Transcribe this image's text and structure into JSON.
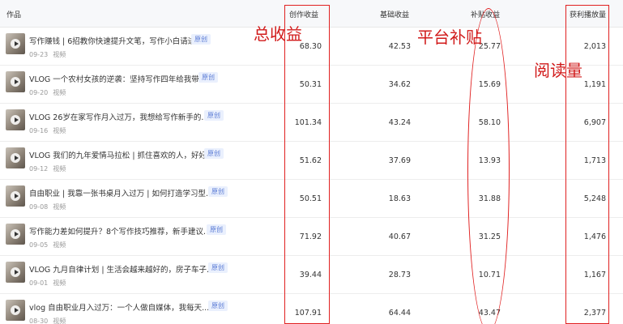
{
  "header": {
    "work": "作品",
    "total_income": "创作收益",
    "base_income": "基础收益",
    "subsidy_income": "补贴收益",
    "plays": "获利播放量"
  },
  "annotations": {
    "total": "总收益",
    "platform_subsidy": "平台补贴",
    "reads": "阅读量",
    "color": "#e02020"
  },
  "rows": [
    {
      "title": "写作赚钱 | 6招教你快速提升文笔，写作小白请进！",
      "badge": "原创",
      "date": "09-23",
      "type": "视频",
      "total": "68.30",
      "base": "42.53",
      "subsidy": "25.77",
      "plays": "2,013"
    },
    {
      "title": "VLOG 一个农村女孩的逆袭：坚持写作四年给我带来...",
      "badge": "原创",
      "date": "09-20",
      "type": "视频",
      "total": "50.31",
      "base": "34.62",
      "subsidy": "15.69",
      "plays": "1,191"
    },
    {
      "title": "VLOG 26岁在家写作月入过万，我想给写作新手的...",
      "badge": "原创",
      "date": "09-16",
      "type": "视频",
      "total": "101.34",
      "base": "43.24",
      "subsidy": "58.10",
      "plays": "6,907"
    },
    {
      "title": "VLOG 我们的九年爱情马拉松 | 抓住喜欢的人，好好...",
      "badge": "原创",
      "date": "09-12",
      "type": "视频",
      "total": "51.62",
      "base": "37.69",
      "subsidy": "13.93",
      "plays": "1,713"
    },
    {
      "title": "自由职业 | 我靠一张书桌月入过万 | 如何打造学习型...",
      "badge": "原创",
      "date": "09-08",
      "type": "视频",
      "total": "50.51",
      "base": "18.63",
      "subsidy": "31.88",
      "plays": "5,248"
    },
    {
      "title": "写作能力差如何提升？8个写作技巧推荐，新手建议...",
      "badge": "原创",
      "date": "09-05",
      "type": "视频",
      "total": "71.92",
      "base": "40.67",
      "subsidy": "31.25",
      "plays": "1,476"
    },
    {
      "title": "VLOG 九月自律计划 | 生活会越来越好的，房子车子...",
      "badge": "原创",
      "date": "09-01",
      "type": "视频",
      "total": "39.44",
      "base": "28.73",
      "subsidy": "10.71",
      "plays": "1,167"
    },
    {
      "title": "vlog 自由职业月入过万：一个人做自媒体，我每天...",
      "badge": "原创",
      "date": "08-30",
      "type": "视频",
      "total": "107.91",
      "base": "64.44",
      "subsidy": "43.47",
      "plays": "2,377"
    }
  ]
}
